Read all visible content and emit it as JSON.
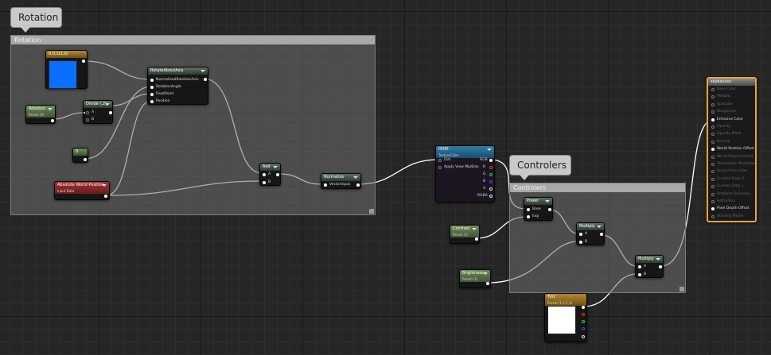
{
  "rotation_group": {
    "bubble": "Rotation",
    "comment": "Rotation",
    "nodes": {
      "color_const": {
        "title": "0,0,1(1,0)",
        "color": "#0a6fff"
      },
      "rotation_param": {
        "title": "Rotation",
        "subtitle": "Param (0)"
      },
      "divide": {
        "title": "Divide (,2)",
        "pins": [
          "A",
          "B"
        ]
      },
      "const_zero": {
        "title": "0"
      },
      "abs_world_pos": {
        "title": "Absolute World Position",
        "subtitle": "Input Data"
      },
      "rotate_about_axis": {
        "title": "RotateAboutAxis",
        "pins": [
          "NormalizedRotationAxis",
          "RotationAngle",
          "PivotPoint",
          "Position"
        ]
      },
      "add": {
        "title": "Add",
        "pins": [
          "A",
          "B"
        ]
      },
      "normalize": {
        "title": "Normalize",
        "pins": [
          "VectorInput"
        ]
      }
    }
  },
  "hdri": {
    "title": "HDRI",
    "subtitle": "TextureCube",
    "inputs": [
      "UVs",
      "Apply View MipBias"
    ],
    "outputs": [
      "RGB",
      "R",
      "G",
      "B",
      "A",
      "RGBA"
    ]
  },
  "controlers_group": {
    "bubble": "Controlers",
    "comment": "Controlers",
    "nodes": {
      "power": {
        "title": "Power",
        "pins": [
          "Base",
          "Exp"
        ]
      },
      "multiply_1": {
        "title": "Multiply",
        "pins": [
          "A",
          "B"
        ]
      },
      "multiply_2": {
        "title": "Multiply",
        "pins": [
          "A",
          "B"
        ]
      },
      "contrast": {
        "title": "Contrast",
        "subtitle": "Param (1)"
      },
      "brightness": {
        "title": "Brightness",
        "subtitle": "Param (1)"
      },
      "tint": {
        "title": "Tint",
        "subtitle": "Param (1,1,1,1)",
        "color": "#ffffff"
      }
    }
  },
  "output_node": {
    "title": "skyboxxxx",
    "pins": [
      {
        "label": "Base Color",
        "active": false
      },
      {
        "label": "Metallic",
        "active": false
      },
      {
        "label": "Specular",
        "active": false
      },
      {
        "label": "Roughness",
        "active": false
      },
      {
        "label": "Emissive Color",
        "active": true
      },
      {
        "label": "Opacity",
        "active": false
      },
      {
        "label": "Opacity Mask",
        "active": false
      },
      {
        "label": "Normal",
        "active": false
      },
      {
        "label": "World Position Offset",
        "active": true
      },
      {
        "label": "World Displacement",
        "active": false
      },
      {
        "label": "Tessellation Multiplier",
        "active": false
      },
      {
        "label": "Subsurface Color",
        "active": false
      },
      {
        "label": "Custom Data 0",
        "active": false
      },
      {
        "label": "Custom Data 1",
        "active": false
      },
      {
        "label": "Ambient Occlusion",
        "active": false
      },
      {
        "label": "Refraction",
        "active": false
      },
      {
        "label": "Pixel Depth Offset",
        "active": true
      },
      {
        "label": "Shading Model",
        "active": false
      }
    ]
  }
}
